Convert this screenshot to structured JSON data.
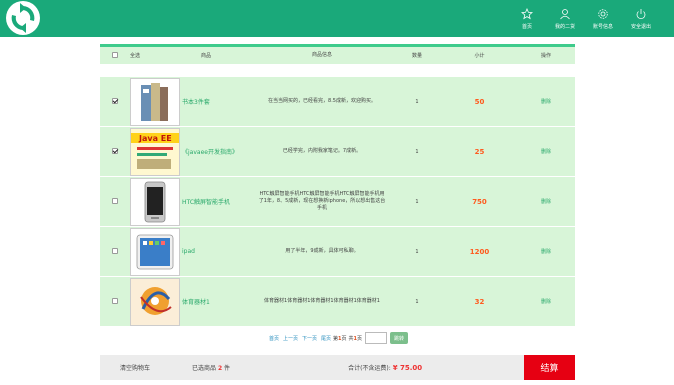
{
  "nav": {
    "items": [
      {
        "label": "首页",
        "icon": "star-icon"
      },
      {
        "label": "我的二货",
        "icon": "user-icon"
      },
      {
        "label": "账号信息",
        "icon": "gear-icon"
      },
      {
        "label": "安全退出",
        "icon": "power-icon"
      }
    ]
  },
  "table": {
    "headers": {
      "select_all": "全选",
      "product": "商品",
      "info": "商品信息",
      "qty": "数量",
      "subtotal": "小计",
      "action": "操作"
    },
    "rows": [
      {
        "checked": true,
        "name": "书本3件套",
        "info": "在当当网买的，已经看完，8.5成新，欢迎购买。",
        "qty": "1",
        "subtotal": "50",
        "action": "删除"
      },
      {
        "checked": true,
        "name": "《javaee开发指南》",
        "info": "已经学完，内附我家笔记。7成新。",
        "qty": "1",
        "subtotal": "25",
        "action": "删除"
      },
      {
        "checked": false,
        "name": "HTC触屏智能手机",
        "info": "HTC触屏智能手机HTC触屏智能手机HTC触屏智能手机用了1年，8、5成新，现在想换新iphone，所以想出售这台手机",
        "qty": "1",
        "subtotal": "750",
        "action": "删除"
      },
      {
        "checked": false,
        "name": "ipad",
        "info": "用了半年，9成新，具体可私聊。",
        "qty": "1",
        "subtotal": "1200",
        "action": "删除"
      },
      {
        "checked": false,
        "name": "体育器材1",
        "info": "体育器材1体育器材1体育器材1体育器材1体育器材1",
        "qty": "1",
        "subtotal": "32",
        "action": "删除"
      }
    ]
  },
  "pager": {
    "first": "首页",
    "prev": "上一页",
    "next": "下一页",
    "last": "尾页",
    "current_prefix": "第",
    "current": "1",
    "current_suffix": "页",
    "total_prefix": "共",
    "total": "1",
    "total_suffix": "页",
    "input_value": "",
    "go": "跳转"
  },
  "footer": {
    "clear": "清空购物车",
    "selected_prefix": "已选商品",
    "selected_count": "2",
    "selected_suffix": "件",
    "total_label": "合计(不含运费):",
    "total_value": "¥ 75.00",
    "checkout": "结算"
  },
  "colors": {
    "header": "#1aa97a",
    "row_bg": "#d8f5d8",
    "price": "#ff5a1e",
    "checkout": "#e60012"
  }
}
